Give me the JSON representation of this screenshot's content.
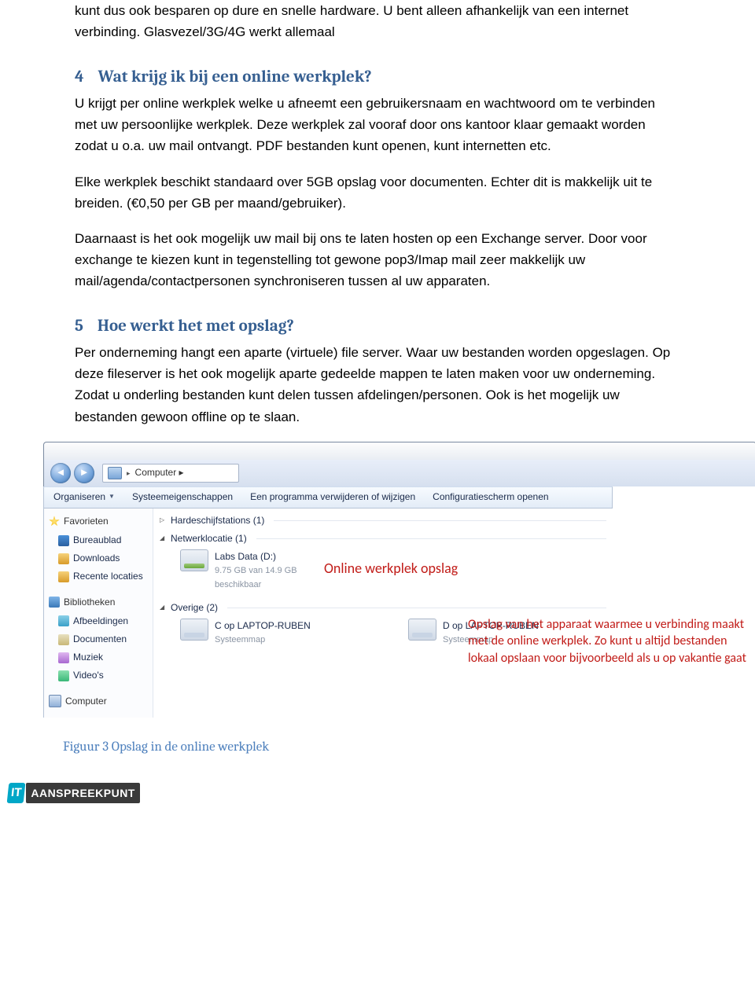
{
  "intro_para": "kunt dus ook besparen op dure en snelle hardware. U bent alleen afhankelijk van een internet verbinding. Glasvezel/3G/4G werkt allemaal",
  "sec4": {
    "num": "4",
    "title": "Wat krijg ik bij een online werkplek?"
  },
  "p4a": "U krijgt per online werkplek welke u afneemt een gebruikersnaam en wachtwoord om te verbinden met uw persoonlijke werkplek. Deze werkplek zal vooraf door ons kantoor klaar gemaakt worden zodat u o.a. uw mail ontvangt. PDF bestanden kunt openen, kunt internetten etc.",
  "p4b": "Elke werkplek beschikt standaard over 5GB opslag voor documenten. Echter dit is makkelijk uit te breiden. (€0,50 per GB per maand/gebruiker).",
  "p4c": "Daarnaast is het ook mogelijk uw mail bij ons te laten hosten op een Exchange server. Door voor exchange te kiezen kunt in tegenstelling tot gewone pop3/Imap mail zeer makkelijk uw mail/agenda/contactpersonen synchroniseren tussen al uw apparaten.",
  "sec5": {
    "num": "5",
    "title": "Hoe werkt het met opslag?"
  },
  "p5": "Per onderneming hangt een aparte (virtuele) file server. Waar uw bestanden worden opgeslagen. Op deze fileserver is het ook mogelijk aparte gedeelde mappen te laten maken voor uw onderneming. Zodat u onderling bestanden kunt delen tussen afdelingen/personen. Ook is het mogelijk uw bestanden gewoon offline op  te slaan.",
  "explorer": {
    "breadcrumb": "Computer  ▸",
    "toolbar": {
      "organiseren": "Organiseren",
      "systeem": "Systeemeigenschappen",
      "programma": "Een programma verwijderen of wijzigen",
      "config": "Configuratiescherm openen"
    },
    "sidebar": {
      "favorieten": "Favorieten",
      "bureaublad": "Bureaublad",
      "downloads": "Downloads",
      "recente": "Recente locaties",
      "biblio": "Bibliotheken",
      "afbeeldingen": "Afbeeldingen",
      "documenten": "Documenten",
      "muziek": "Muziek",
      "videos": "Video's",
      "computer": "Computer"
    },
    "groups": {
      "hdd": "Hardeschijfstations (1)",
      "net": "Netwerklocatie (1)",
      "overige": "Overige (2)"
    },
    "drives": {
      "labs": {
        "name": "Labs Data (D:)",
        "sub": "9.75 GB van 14.9 GB beschikbaar"
      },
      "c": {
        "name": "C op LAPTOP-RUBEN",
        "sub": "Systeemmap"
      },
      "d": {
        "name": "D op LAPTOP-RUBEN",
        "sub": "Systeemmap"
      }
    },
    "callout1": "Online werkplek opslag",
    "callout2": "Opslag van het apparaat waarmee u verbinding maakt met de online werkplek. Zo kunt u altijd bestanden lokaal opslaan voor bijvoorbeeld als u op vakantie gaat"
  },
  "caption": "Figuur 3 Opslag in de online werkplek",
  "logo": {
    "it": "IT",
    "asp": "AANSPREEKPUNT"
  }
}
